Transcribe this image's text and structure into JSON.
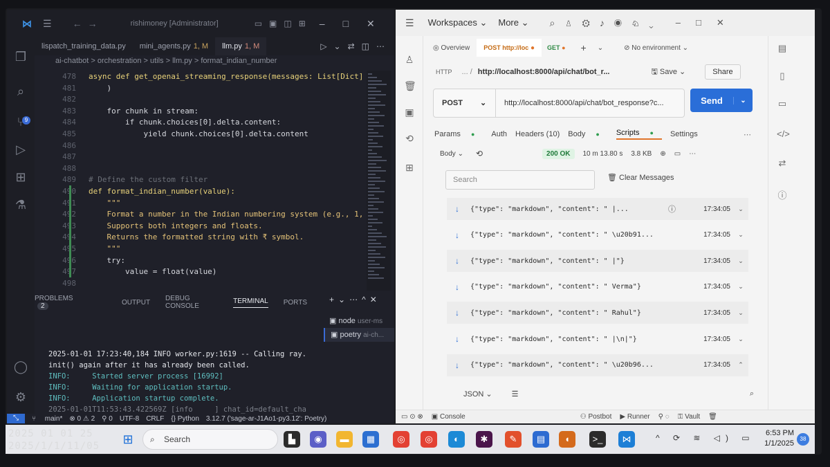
{
  "vscode": {
    "title": "rishimoney [Administrator]",
    "tabs": [
      {
        "label": "lispatch_training_data.py",
        "mod": ""
      },
      {
        "label": "mini_agents.py",
        "mod": "1, M"
      },
      {
        "label": "llm.py",
        "mod": "1, M"
      }
    ],
    "breadcrumb": "ai-chatbot  >  orchestration  >  utils  >  llm.py  >  format_indian_number",
    "lines": [
      {
        "n": "478",
        "text": "async def get_openai_streaming_response(messages: List[Dict]"
      },
      {
        "n": "481",
        "text": "    )"
      },
      {
        "n": "482",
        "text": ""
      },
      {
        "n": "483",
        "text": "    for chunk in stream:"
      },
      {
        "n": "484",
        "text": "        if chunk.choices[0].delta.content:"
      },
      {
        "n": "485",
        "text": "            yield chunk.choices[0].delta.content"
      },
      {
        "n": "486",
        "text": ""
      },
      {
        "n": "487",
        "text": ""
      },
      {
        "n": "488",
        "text": ""
      },
      {
        "n": "489",
        "text": "# Define the custom filter"
      },
      {
        "n": "490",
        "text": "def format_indian_number(value):"
      },
      {
        "n": "491",
        "text": "    \"\"\""
      },
      {
        "n": "492",
        "text": "    Format a number in the Indian numbering system (e.g., 1,"
      },
      {
        "n": "493",
        "text": "    Supports both integers and floats."
      },
      {
        "n": "494",
        "text": "    Returns the formatted string with ₹ symbol."
      },
      {
        "n": "495",
        "text": "    \"\"\""
      },
      {
        "n": "496",
        "text": "    try:"
      },
      {
        "n": "497",
        "text": "        value = float(value)"
      },
      {
        "n": "498",
        "text": ""
      }
    ],
    "panel": {
      "tabs": [
        "PROBLEMS",
        "OUTPUT",
        "DEBUG CONSOLE",
        "TERMINAL",
        "PORTS"
      ],
      "problems_count": "2",
      "terminals": [
        {
          "name": "node",
          "sub": "user-ms"
        },
        {
          "name": "poetry",
          "sub": "ai-ch..."
        }
      ],
      "output": [
        "2025-01-01 17:23:40,184 INFO worker.py:1619 -- Calling ray.",
        "init() again after it has already been called.",
        "INFO:     Started server process [16992]",
        "INFO:     Waiting for application startup.",
        "INFO:     Application startup complete.",
        "2025-01-01T11:53:43.422569Z [info     ] chat_id=default_cha"
      ]
    },
    "status": {
      "branch": "main*",
      "errors": "⊗ 0 ⚠ 2",
      "ports": "⚲ 0",
      "encoding": "UTF-8",
      "eol": "CRLF",
      "lang": "{} Python",
      "interpreter": "3.12.7 ('sage-ar-J1Ao1-py3.12': Poetry)"
    }
  },
  "postman": {
    "workspaces": "Workspaces",
    "more": "More",
    "tab_overview": "Overview",
    "tab_post": "POST http://loc",
    "tab_get": "GET",
    "environment": "No environment",
    "path_url": "http://localhost:8000/api/chat/bot_r...",
    "save": "Save",
    "share": "Share",
    "method": "POST",
    "url": "http://localhost:8000/api/chat/bot_response?c...",
    "send": "Send",
    "subtabs": [
      "Params",
      "Auth",
      "Headers (10)",
      "Body",
      "Scripts",
      "Settings"
    ],
    "body_label": "Body",
    "status_code": "200 OK",
    "time": "10 m 13.80 s",
    "size": "3.8 KB",
    "search_placeholder": "Search",
    "clear_messages": "Clear Messages",
    "messages": [
      {
        "text": "{\"type\": \"markdown\", \"content\": \" |...",
        "time": "17:34:05",
        "info": true
      },
      {
        "text": "{\"type\": \"markdown\", \"content\": \" \\u20b91...",
        "time": "17:34:05"
      },
      {
        "text": "{\"type\": \"markdown\", \"content\": \" |\"}",
        "time": "17:34:05"
      },
      {
        "text": "{\"type\": \"markdown\", \"content\": \" Verma\"}",
        "time": "17:34:05"
      },
      {
        "text": "{\"type\": \"markdown\", \"content\": \" Rahul\"}",
        "time": "17:34:05"
      },
      {
        "text": "{\"type\": \"markdown\", \"content\": \" |\\n|\"}",
        "time": "17:34:05"
      },
      {
        "text": "{\"type\": \"markdown\", \"content\": \" \\u20b96...",
        "time": "17:34:05"
      }
    ],
    "format": "JSON",
    "statusbar": {
      "console": "Console",
      "postbot": "Postbot",
      "runner": "Runner",
      "vault": "Vault"
    }
  },
  "taskbar": {
    "search": "Search",
    "time": "6:53 PM",
    "date": "1/1/2025",
    "notifications": "38"
  },
  "overlay_stamp": [
    "2025 01 01 25",
    "2025/1/1/11/05"
  ]
}
